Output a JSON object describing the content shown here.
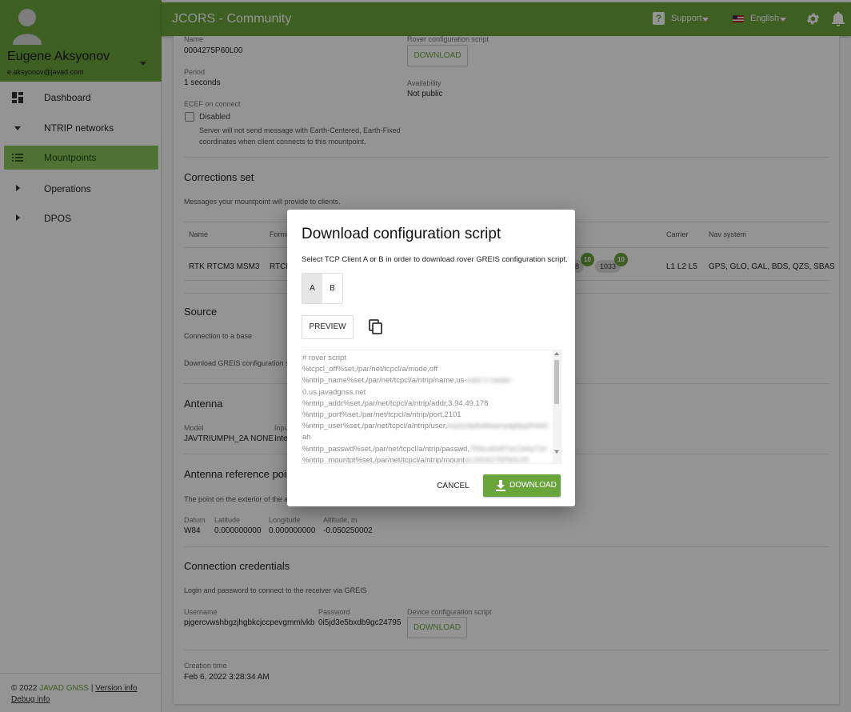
{
  "app": {
    "title": "JCORS - Community"
  },
  "header": {
    "support_label": "Support",
    "language_label": "English"
  },
  "user": {
    "name": "Eugene Aksyonov",
    "email": "e.aksyonov@javad.com"
  },
  "sidebar": {
    "items": [
      {
        "label": "Dashboard"
      },
      {
        "label": "NTRIP networks"
      },
      {
        "label": "Mountpoints"
      },
      {
        "label": "Operations"
      },
      {
        "label": "DPOS"
      }
    ],
    "footer": {
      "copyright": "© 2022",
      "brand": "JAVAD GNSS",
      "sep": "|",
      "version": "Version info",
      "debug": "Debug info"
    }
  },
  "details": {
    "name_label": "Name",
    "name_value": "0004275P60L00",
    "period_label": "Period",
    "period_value": "1 seconds",
    "ecef_label": "ECEF on connect",
    "ecef_checkbox_label": "Disabled",
    "ecef_hint_1": "Server will not send message with Earth-Centered, Earth-Fixed",
    "ecef_hint_2": "coordinates when client connects to this mountpoint.",
    "rover_label": "Rover configuration script",
    "rover_download": "DOWNLOAD",
    "availability_label": "Availability",
    "availability_value": "Not public"
  },
  "corrections": {
    "title": "Corrections set",
    "desc": "Messages your mountpoint will provide to clients.",
    "headers": {
      "name": "Name",
      "format": "Forma",
      "carrier": "Carrier",
      "nav": "Nav system"
    },
    "row": {
      "name": "RTK RTCM3 MSM3",
      "format": "RTCM",
      "carrier": "L1 L2 L5",
      "nav": "GPS, GLO, GAL, BDS, QZS, SBAS"
    },
    "chips": [
      {
        "text": "08",
        "count": "10"
      },
      {
        "text": "1033",
        "count": "10"
      }
    ]
  },
  "source": {
    "title": "Source",
    "desc": "Connection to a base",
    "greis": "Download GREIS configuration sc"
  },
  "antenna": {
    "title": "Antenna",
    "model_label": "Model",
    "model_value": "JAVTRIUMPH_2A NONE",
    "input_label": "Inpu",
    "input_value": "Inte"
  },
  "arp": {
    "title": "Antenna reference poin",
    "desc": "The point on the exterior of the an",
    "datum_label": "Datum",
    "datum_value": "W84",
    "lat_label": "Latitude",
    "lat_value": "0.000000000",
    "lon_label": "Longitude",
    "lon_value": "0.000000000",
    "alt_label": "Altitude, m",
    "alt_value": "-0.050250002"
  },
  "credentials": {
    "title": "Connection credentials",
    "desc": "Login and password to connect to the receiver via GREIS",
    "username_label": "Username",
    "username_value": "pjgercvwshbgzjhgbkcjccpevgmmlvkb",
    "password_label": "Password",
    "password_value": "0i5jd3e5bxdb9gc24795",
    "device_label": "Device configuration script",
    "device_download": "DOWNLOAD"
  },
  "creation": {
    "label": "Creation time",
    "value": "Feb 6, 2022 3:28:34 AM"
  },
  "dialog": {
    "title": "Download configuration script",
    "desc": "Select TCP Client A or B in order to download rover GREIS configuration script.",
    "option_a": "A",
    "option_b": "B",
    "selected": "A",
    "preview": "PREVIEW",
    "script_lines": [
      {
        "text": "# rover script"
      },
      {
        "text": "%tcpcl_off%set,/par/net/tcpcl/a/mode,off"
      },
      {
        "text": "%ntrip_name%set,/par/net/tcpcl/a/ntrip/name,us-",
        "blur": "east-1-caster-"
      },
      {
        "text": "0.us.javadgnss.net"
      },
      {
        "text": "%ntrip_addr%set,/par/net/tcpcl/a/ntrip/addr,3.94.49.178"
      },
      {
        "text": "%ntrip_port%set,/par/net/tcpcl/a/ntrip/port,2101"
      },
      {
        "text": "%ntrip_user%set,/par/net/tcpcl/a/ntrip/user,",
        "blur": "ksyrpztptlukkaanyagbjqzfciteh"
      },
      {
        "text": "ah"
      },
      {
        "text": "%ntrip_passwd%set,/par/net/tcpcl/a/ntrip/passwd,",
        "blur": "7f0bcd0d97a12d4y710"
      },
      {
        "text": "%ntrip_mountpt%set,/par/net/tcpcl/a/ntrip/mount",
        "blur": "pt,0004275P60L00"
      }
    ],
    "cancel": "CANCEL",
    "download": "DOWNLOAD"
  },
  "colors": {
    "accent": "#6aa43c",
    "active_nav": "#8bc45a"
  }
}
